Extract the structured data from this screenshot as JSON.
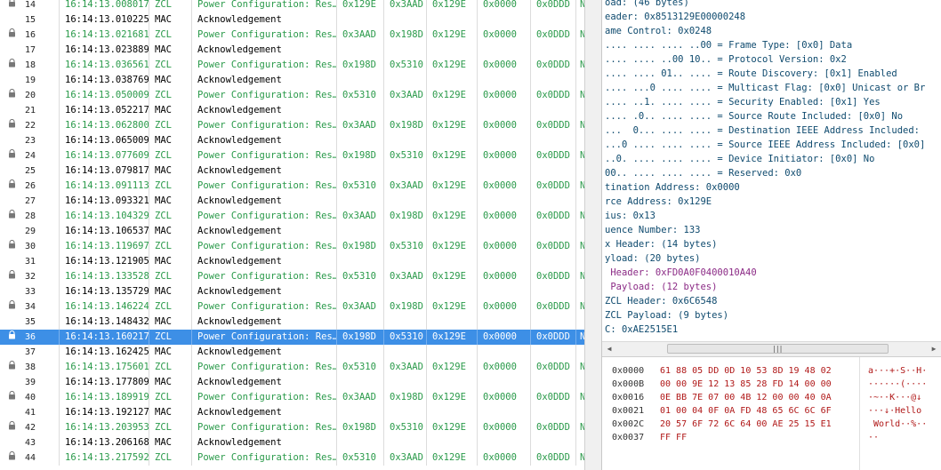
{
  "packets": [
    {
      "no": "14",
      "time": "16:14:13.008017",
      "proto": "ZCL",
      "info": "Power Configuration: Res…",
      "a": "0x129E",
      "b": "0x3AAD",
      "c": "0x129E",
      "d": "0x0000",
      "e": "0x0DDD",
      "f": "N",
      "locked": true,
      "type": "zcl"
    },
    {
      "no": "15",
      "time": "16:14:13.010225",
      "proto": "MAC",
      "info": "Acknowledgement",
      "a": "",
      "b": "",
      "c": "",
      "d": "",
      "e": "",
      "f": "",
      "locked": false,
      "type": "mac"
    },
    {
      "no": "16",
      "time": "16:14:13.021681",
      "proto": "ZCL",
      "info": "Power Configuration: Res…",
      "a": "0x3AAD",
      "b": "0x198D",
      "c": "0x129E",
      "d": "0x0000",
      "e": "0x0DDD",
      "f": "N",
      "locked": true,
      "type": "zcl"
    },
    {
      "no": "17",
      "time": "16:14:13.023889",
      "proto": "MAC",
      "info": "Acknowledgement",
      "a": "",
      "b": "",
      "c": "",
      "d": "",
      "e": "",
      "f": "",
      "locked": false,
      "type": "mac"
    },
    {
      "no": "18",
      "time": "16:14:13.036561",
      "proto": "ZCL",
      "info": "Power Configuration: Res…",
      "a": "0x198D",
      "b": "0x5310",
      "c": "0x129E",
      "d": "0x0000",
      "e": "0x0DDD",
      "f": "N",
      "locked": true,
      "type": "zcl"
    },
    {
      "no": "19",
      "time": "16:14:13.038769",
      "proto": "MAC",
      "info": "Acknowledgement",
      "a": "",
      "b": "",
      "c": "",
      "d": "",
      "e": "",
      "f": "",
      "locked": false,
      "type": "mac"
    },
    {
      "no": "20",
      "time": "16:14:13.050009",
      "proto": "ZCL",
      "info": "Power Configuration: Res…",
      "a": "0x5310",
      "b": "0x3AAD",
      "c": "0x129E",
      "d": "0x0000",
      "e": "0x0DDD",
      "f": "N",
      "locked": true,
      "type": "zcl"
    },
    {
      "no": "21",
      "time": "16:14:13.052217",
      "proto": "MAC",
      "info": "Acknowledgement",
      "a": "",
      "b": "",
      "c": "",
      "d": "",
      "e": "",
      "f": "",
      "locked": false,
      "type": "mac"
    },
    {
      "no": "22",
      "time": "16:14:13.062800",
      "proto": "ZCL",
      "info": "Power Configuration: Res…",
      "a": "0x3AAD",
      "b": "0x198D",
      "c": "0x129E",
      "d": "0x0000",
      "e": "0x0DDD",
      "f": "N",
      "locked": true,
      "type": "zcl"
    },
    {
      "no": "23",
      "time": "16:14:13.065009",
      "proto": "MAC",
      "info": "Acknowledgement",
      "a": "",
      "b": "",
      "c": "",
      "d": "",
      "e": "",
      "f": "",
      "locked": false,
      "type": "mac"
    },
    {
      "no": "24",
      "time": "16:14:13.077609",
      "proto": "ZCL",
      "info": "Power Configuration: Res…",
      "a": "0x198D",
      "b": "0x5310",
      "c": "0x129E",
      "d": "0x0000",
      "e": "0x0DDD",
      "f": "N",
      "locked": true,
      "type": "zcl"
    },
    {
      "no": "25",
      "time": "16:14:13.079817",
      "proto": "MAC",
      "info": "Acknowledgement",
      "a": "",
      "b": "",
      "c": "",
      "d": "",
      "e": "",
      "f": "",
      "locked": false,
      "type": "mac"
    },
    {
      "no": "26",
      "time": "16:14:13.091113",
      "proto": "ZCL",
      "info": "Power Configuration: Res…",
      "a": "0x5310",
      "b": "0x3AAD",
      "c": "0x129E",
      "d": "0x0000",
      "e": "0x0DDD",
      "f": "N",
      "locked": true,
      "type": "zcl"
    },
    {
      "no": "27",
      "time": "16:14:13.093321",
      "proto": "MAC",
      "info": "Acknowledgement",
      "a": "",
      "b": "",
      "c": "",
      "d": "",
      "e": "",
      "f": "",
      "locked": false,
      "type": "mac"
    },
    {
      "no": "28",
      "time": "16:14:13.104329",
      "proto": "ZCL",
      "info": "Power Configuration: Res…",
      "a": "0x3AAD",
      "b": "0x198D",
      "c": "0x129E",
      "d": "0x0000",
      "e": "0x0DDD",
      "f": "N",
      "locked": true,
      "type": "zcl"
    },
    {
      "no": "29",
      "time": "16:14:13.106537",
      "proto": "MAC",
      "info": "Acknowledgement",
      "a": "",
      "b": "",
      "c": "",
      "d": "",
      "e": "",
      "f": "",
      "locked": false,
      "type": "mac"
    },
    {
      "no": "30",
      "time": "16:14:13.119697",
      "proto": "ZCL",
      "info": "Power Configuration: Res…",
      "a": "0x198D",
      "b": "0x5310",
      "c": "0x129E",
      "d": "0x0000",
      "e": "0x0DDD",
      "f": "N",
      "locked": true,
      "type": "zcl"
    },
    {
      "no": "31",
      "time": "16:14:13.121905",
      "proto": "MAC",
      "info": "Acknowledgement",
      "a": "",
      "b": "",
      "c": "",
      "d": "",
      "e": "",
      "f": "",
      "locked": false,
      "type": "mac"
    },
    {
      "no": "32",
      "time": "16:14:13.133528",
      "proto": "ZCL",
      "info": "Power Configuration: Res…",
      "a": "0x5310",
      "b": "0x3AAD",
      "c": "0x129E",
      "d": "0x0000",
      "e": "0x0DDD",
      "f": "N",
      "locked": true,
      "type": "zcl"
    },
    {
      "no": "33",
      "time": "16:14:13.135729",
      "proto": "MAC",
      "info": "Acknowledgement",
      "a": "",
      "b": "",
      "c": "",
      "d": "",
      "e": "",
      "f": "",
      "locked": false,
      "type": "mac"
    },
    {
      "no": "34",
      "time": "16:14:13.146224",
      "proto": "ZCL",
      "info": "Power Configuration: Res…",
      "a": "0x3AAD",
      "b": "0x198D",
      "c": "0x129E",
      "d": "0x0000",
      "e": "0x0DDD",
      "f": "N",
      "locked": true,
      "type": "zcl"
    },
    {
      "no": "35",
      "time": "16:14:13.148432",
      "proto": "MAC",
      "info": "Acknowledgement",
      "a": "",
      "b": "",
      "c": "",
      "d": "",
      "e": "",
      "f": "",
      "locked": false,
      "type": "mac"
    },
    {
      "no": "36",
      "time": "16:14:13.160217",
      "proto": "ZCL",
      "info": "Power Configuration: Res…",
      "a": "0x198D",
      "b": "0x5310",
      "c": "0x129E",
      "d": "0x0000",
      "e": "0x0DDD",
      "f": "N",
      "locked": true,
      "type": "zcl",
      "selected": true
    },
    {
      "no": "37",
      "time": "16:14:13.162425",
      "proto": "MAC",
      "info": "Acknowledgement",
      "a": "",
      "b": "",
      "c": "",
      "d": "",
      "e": "",
      "f": "",
      "locked": false,
      "type": "mac"
    },
    {
      "no": "38",
      "time": "16:14:13.175601",
      "proto": "ZCL",
      "info": "Power Configuration: Res…",
      "a": "0x5310",
      "b": "0x3AAD",
      "c": "0x129E",
      "d": "0x0000",
      "e": "0x0DDD",
      "f": "N",
      "locked": true,
      "type": "zcl"
    },
    {
      "no": "39",
      "time": "16:14:13.177809",
      "proto": "MAC",
      "info": "Acknowledgement",
      "a": "",
      "b": "",
      "c": "",
      "d": "",
      "e": "",
      "f": "",
      "locked": false,
      "type": "mac"
    },
    {
      "no": "40",
      "time": "16:14:13.189919",
      "proto": "ZCL",
      "info": "Power Configuration: Res…",
      "a": "0x3AAD",
      "b": "0x198D",
      "c": "0x129E",
      "d": "0x0000",
      "e": "0x0DDD",
      "f": "N",
      "locked": true,
      "type": "zcl"
    },
    {
      "no": "41",
      "time": "16:14:13.192127",
      "proto": "MAC",
      "info": "Acknowledgement",
      "a": "",
      "b": "",
      "c": "",
      "d": "",
      "e": "",
      "f": "",
      "locked": false,
      "type": "mac"
    },
    {
      "no": "42",
      "time": "16:14:13.203953",
      "proto": "ZCL",
      "info": "Power Configuration: Res…",
      "a": "0x198D",
      "b": "0x5310",
      "c": "0x129E",
      "d": "0x0000",
      "e": "0x0DDD",
      "f": "N",
      "locked": true,
      "type": "zcl"
    },
    {
      "no": "43",
      "time": "16:14:13.206168",
      "proto": "MAC",
      "info": "Acknowledgement",
      "a": "",
      "b": "",
      "c": "",
      "d": "",
      "e": "",
      "f": "",
      "locked": false,
      "type": "mac"
    },
    {
      "no": "44",
      "time": "16:14:13.217592",
      "proto": "ZCL",
      "info": "Power Configuration: Res…",
      "a": "0x5310",
      "b": "0x3AAD",
      "c": "0x129E",
      "d": "0x0000",
      "e": "0x0DDD",
      "f": "N",
      "locked": true,
      "type": "zcl"
    }
  ],
  "detail": [
    {
      "text": "oad: (46 bytes)",
      "color": "blue"
    },
    {
      "text": "eader: 0x8513129E00000248",
      "color": "blue"
    },
    {
      "text": "ame Control: 0x0248",
      "color": "blue"
    },
    {
      "text": ".... .... .... ..00 = Frame Type: [0x0] Data",
      "color": "blue"
    },
    {
      "text": ".... .... ..00 10.. = Protocol Version: 0x2",
      "color": "blue"
    },
    {
      "text": ".... .... 01.. .... = Route Discovery: [0x1] Enabled",
      "color": "blue"
    },
    {
      "text": ".... ...0 .... .... = Multicast Flag: [0x0] Unicast or Br",
      "color": "blue"
    },
    {
      "text": ".... ..1. .... .... = Security Enabled: [0x1] Yes",
      "color": "blue"
    },
    {
      "text": ".... .0.. .... .... = Source Route Included: [0x0] No",
      "color": "blue"
    },
    {
      "text": "...  0... .... .... = Destination IEEE Address Included:",
      "color": "blue"
    },
    {
      "text": "...0 .... .... .... = Source IEEE Address Included: [0x0]",
      "color": "blue"
    },
    {
      "text": "..0. .... .... .... = Device Initiator: [0x0] No",
      "color": "blue"
    },
    {
      "text": "00.. .... .... .... = Reserved: 0x0",
      "color": "blue"
    },
    {
      "text": "tination Address: 0x0000",
      "color": "blue"
    },
    {
      "text": "rce Address: 0x129E",
      "color": "blue"
    },
    {
      "text": "ius: 0x13",
      "color": "blue"
    },
    {
      "text": "uence Number: 133",
      "color": "blue"
    },
    {
      "text": "x Header: (14 bytes)",
      "color": "blue"
    },
    {
      "text": "yload: (20 bytes)",
      "color": "blue"
    },
    {
      "text": " Header: 0xFD0A0F0400010A40",
      "color": "purple"
    },
    {
      "text": " Payload: (12 bytes)",
      "color": "purple"
    },
    {
      "text": "ZCL Header: 0x6C6548",
      "color": "blue"
    },
    {
      "text": "ZCL Payload: (9 bytes)",
      "color": "blue"
    },
    {
      "text": "C: 0xAE2515E1",
      "color": "blue"
    }
  ],
  "bytes": [
    {
      "offset": "0x0000",
      "hex": "61 88 05 DD 0D 10 53 8D 19 48 02",
      "ascii": "a···+·S··H·"
    },
    {
      "offset": "0x000B",
      "hex": "00 00 9E 12 13 85 28 FD 14 00 00",
      "ascii": "······(····"
    },
    {
      "offset": "0x0016",
      "hex": "0E BB 7E 07 00 4B 12 00 00 40 0A",
      "ascii": "·~··K···@↓"
    },
    {
      "offset": "0x0021",
      "hex": "01 00 04 0F 0A FD 48 65 6C 6C 6F",
      "ascii": "···↓·Hello"
    },
    {
      "offset": "0x002C",
      "hex": "20 57 6F 72 6C 64 00 AE 25 15 E1",
      "ascii": " World··%··"
    },
    {
      "offset": "0x0037",
      "hex": "FF FF",
      "ascii": "··"
    }
  ],
  "icons": {
    "lock": "lock-icon",
    "scroll_left": "arrow-left-icon",
    "scroll_right": "arrow-right-icon",
    "thumb_grip": "grip-icon"
  },
  "colors": {
    "zcl_text": "#2a9a4a",
    "mac_text": "#000000",
    "selection": "#3d8fe6",
    "detail_text": "#0e4a6e",
    "detail_purple": "#8b2a85",
    "bytes_text": "#b01818"
  }
}
